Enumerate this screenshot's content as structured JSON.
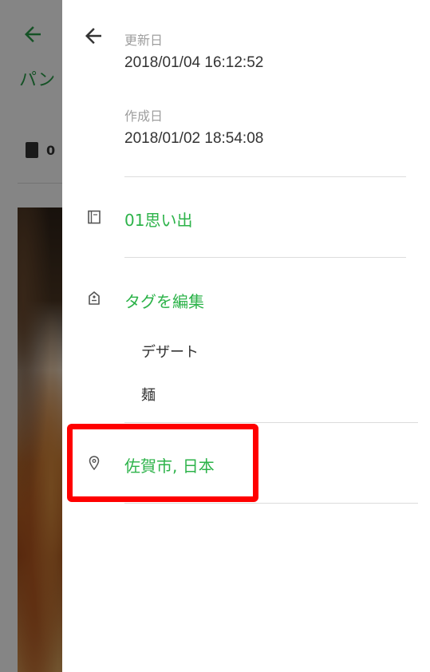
{
  "background": {
    "title": "パン",
    "notebook_label": "0"
  },
  "drawer": {
    "updated_label": "更新日",
    "updated_value": "2018/01/04 16:12:52",
    "created_label": "作成日",
    "created_value": "2018/01/02 18:54:08",
    "notebook": "01思い出",
    "edit_tags": "タグを編集",
    "tags": [
      "デザート",
      "麺"
    ],
    "location": "佐賀市, 日本"
  },
  "colors": {
    "accent_green": "#2db34a",
    "highlight_red": "#ff0000"
  }
}
